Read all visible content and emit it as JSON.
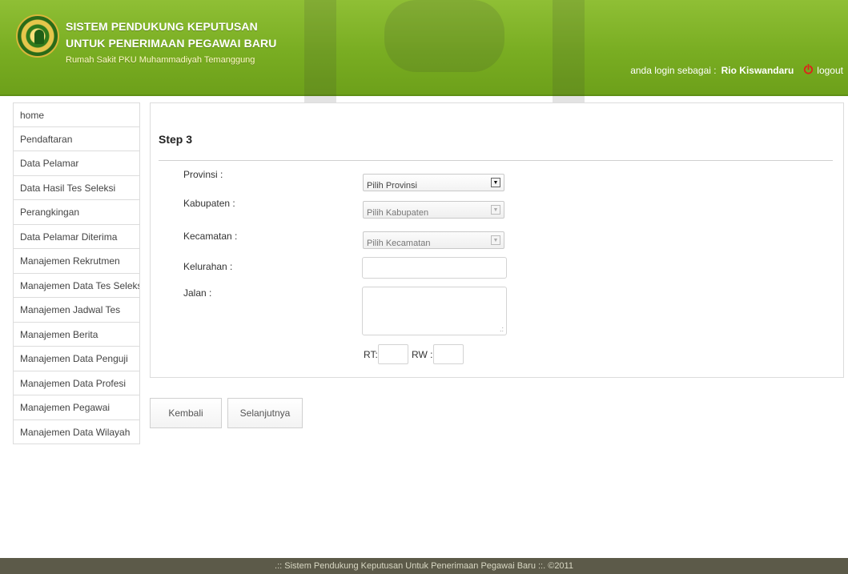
{
  "header": {
    "title_line1": "SISTEM PENDUKUNG KEPUTUSAN",
    "title_line2": "UNTUK PENERIMAAN PEGAWAI BARU",
    "subtitle": "Rumah Sakit PKU Muhammadiyah Temanggung",
    "login_prefix": "anda login sebagai :",
    "login_user": "Rio Kiswandaru",
    "logout_label": "logout",
    "logout_icon": "power-icon"
  },
  "sidebar": {
    "items": [
      {
        "label": "home"
      },
      {
        "label": "Pendaftaran"
      },
      {
        "label": "Data Pelamar"
      },
      {
        "label": "Data Hasil Tes Seleksi"
      },
      {
        "label": "Perangkingan"
      },
      {
        "label": "Data Pelamar Diterima"
      },
      {
        "label": "Manajemen Rekrutmen"
      },
      {
        "label": "Manajemen Data Tes Seleksi"
      },
      {
        "label": "Manajemen Jadwal Tes"
      },
      {
        "label": "Manajemen Berita"
      },
      {
        "label": "Manajemen Data Penguji"
      },
      {
        "label": "Manajemen Data Profesi"
      },
      {
        "label": "Manajemen Pegawai"
      },
      {
        "label": "Manajemen Data Wilayah"
      }
    ]
  },
  "form": {
    "step_title": "Step 3",
    "provinsi_label": "Provinsi :",
    "provinsi_value": "Pilih Provinsi",
    "kabupaten_label": "Kabupaten :",
    "kabupaten_value": "Pilih Kabupaten",
    "kecamatan_label": "Kecamatan :",
    "kecamatan_value": "Pilih Kecamatan",
    "kelurahan_label": "Kelurahan :",
    "kelurahan_value": "",
    "jalan_label": "Jalan :",
    "jalan_value": "",
    "rt_label": "RT:",
    "rt_value": "",
    "rw_label": "RW :",
    "rw_value": ""
  },
  "buttons": {
    "back_label": "Kembali",
    "next_label": "Selanjutnya"
  },
  "footer": {
    "text": ".:: Sistem Pendukung Keputusan Untuk Penerimaan Pegawai Baru ::. ©2011"
  },
  "colors": {
    "header_green": "#79ad22",
    "footer_bg": "#5c5a49",
    "logout_red": "#e0201b"
  }
}
